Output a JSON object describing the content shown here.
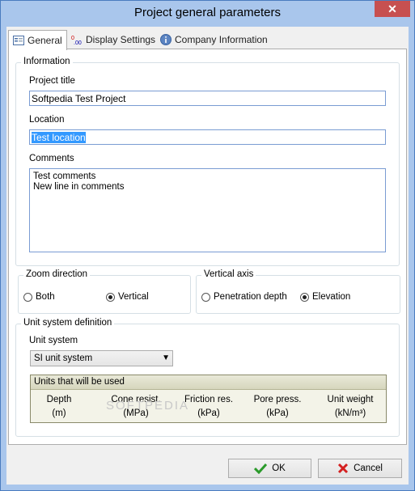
{
  "window": {
    "title": "Project general parameters",
    "close_glyph": "✕"
  },
  "tabs": [
    {
      "label": "General",
      "icon": "form-icon"
    },
    {
      "label": "Display Settings",
      "icon": "decimal-icon"
    },
    {
      "label": "Company Information",
      "icon": "info-icon"
    }
  ],
  "information": {
    "group_label": "Information",
    "project_title_label": "Project title",
    "project_title_value": "Softpedia Test Project",
    "location_label": "Location",
    "location_value": "Test location",
    "comments_label": "Comments",
    "comments_line1": "Test comments",
    "comments_line2": "New line in comments"
  },
  "zoom_direction": {
    "group_label": "Zoom direction",
    "options": [
      {
        "label": "Both",
        "checked": false
      },
      {
        "label": "Vertical",
        "checked": true
      }
    ]
  },
  "vertical_axis": {
    "group_label": "Vertical axis",
    "options": [
      {
        "label": "Penetration depth",
        "checked": false
      },
      {
        "label": "Elevation",
        "checked": true
      }
    ]
  },
  "unit_system": {
    "group_label": "Unit system definition",
    "field_label": "Unit system",
    "selected": "SI unit system",
    "units_header": "Units that will be used",
    "columns": [
      {
        "name": "Depth",
        "unit": "(m)"
      },
      {
        "name": "Cone resist.",
        "unit": "(MPa)"
      },
      {
        "name": "Friction res.",
        "unit": "(kPa)"
      },
      {
        "name": "Pore press.",
        "unit": "(kPa)"
      },
      {
        "name": "Unit weight",
        "unit": "(kN/m³)"
      }
    ]
  },
  "buttons": {
    "ok": "OK",
    "cancel": "Cancel"
  },
  "watermark": "SOFTPEDIA"
}
